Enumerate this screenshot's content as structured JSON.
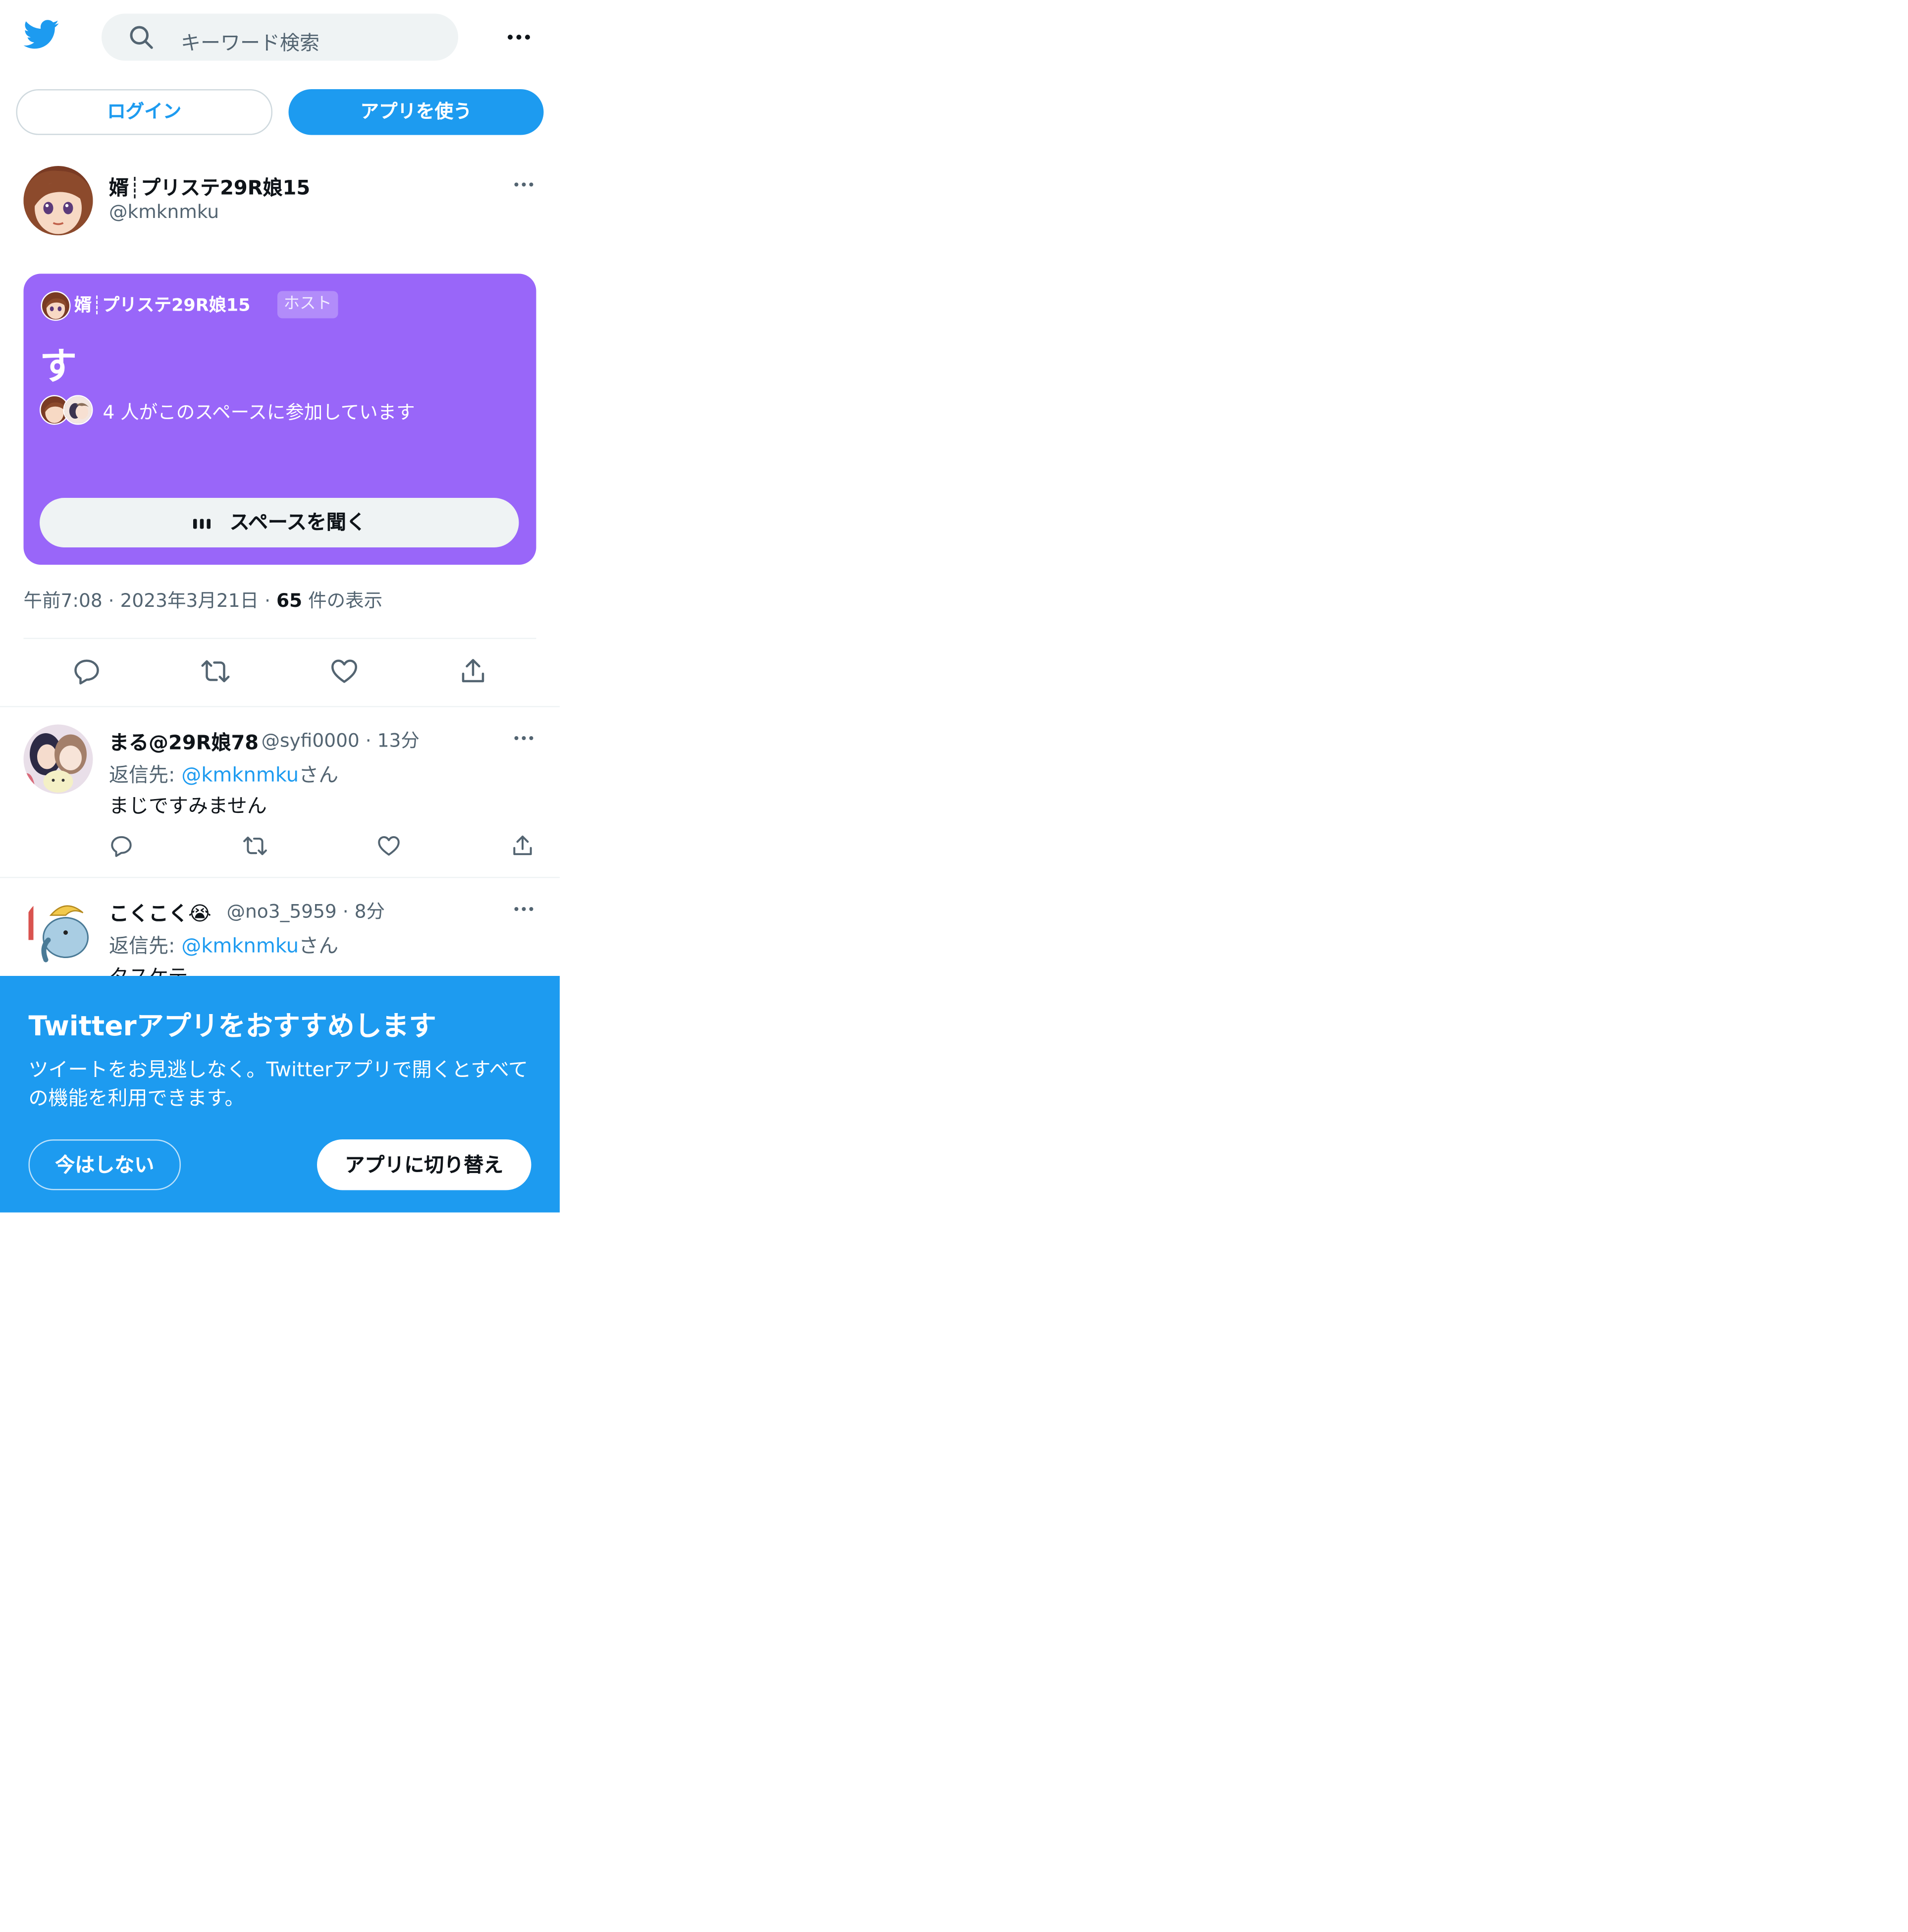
{
  "topbar": {
    "search_placeholder": "キーワード検索",
    "logo_icon": "twitter-bird-icon",
    "more_icon": "more-horizontal-icon"
  },
  "auth": {
    "login_label": "ログイン",
    "use_app_label": "アプリを使う"
  },
  "tweet": {
    "author_name": "婿┊プリステ29R娘15",
    "author_handle": "@kmknmku",
    "space": {
      "host_name": "婿┊プリステ29R娘15",
      "host_badge": "ホスト",
      "title": "す",
      "participants_text": "4 人がこのスペースに参加しています",
      "listen_label": "スペースを聞く"
    },
    "meta": {
      "time": "午前7:08",
      "date": "2023年3月21日",
      "views_count": "65",
      "views_label": " 件の表示",
      "separator": "·"
    },
    "actions": [
      "reply-icon",
      "retweet-icon",
      "like-icon",
      "share-icon"
    ]
  },
  "replies": [
    {
      "name": "まる@29R娘78",
      "handle": "@syfi0000",
      "time": "13分",
      "reply_to_label": "返信先: ",
      "reply_to_handle": "@kmknmku",
      "reply_to_suffix": "さん",
      "text": "まじですみません"
    },
    {
      "name": "こくこく😭",
      "handle": "@no3_5959",
      "time": "8分",
      "reply_to_label": "返信先: ",
      "reply_to_handle": "@kmknmku",
      "reply_to_suffix": "さん",
      "text": "タスケテ"
    }
  ],
  "banner": {
    "title": "Twitterアプリをおすすめします",
    "body": "ツイートをお見逃しなく。Twitterアプリで開くとすべての機能を利用できます。",
    "not_now_label": "今はしない",
    "switch_label": "アプリに切り替え"
  },
  "colors": {
    "brand_blue": "#1d9bf0",
    "space_purple": "#9966f9",
    "text_primary": "#0f1419",
    "text_secondary": "#536471"
  }
}
